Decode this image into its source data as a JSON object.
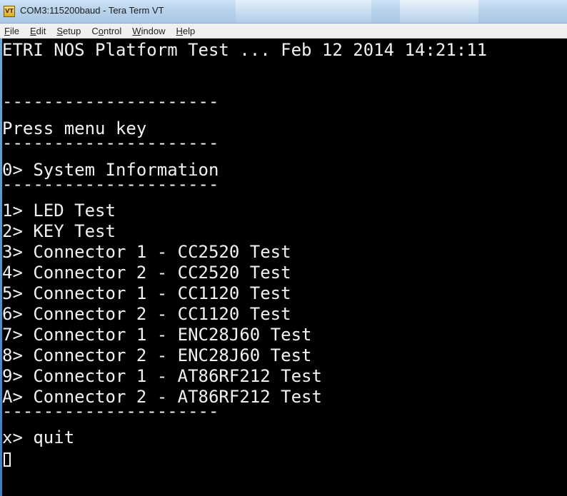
{
  "window": {
    "title": "COM3:115200baud - Tera Term VT",
    "icon": "tera-term-app-icon",
    "icon_glyph": "VT"
  },
  "menu": [
    {
      "name": "file",
      "accel": "F",
      "rest": "ile"
    },
    {
      "name": "edit",
      "accel": "E",
      "rest": "dit"
    },
    {
      "name": "setup",
      "accel": "S",
      "rest": "etup"
    },
    {
      "name": "control",
      "pre": "C",
      "accel": "o",
      "rest": "ntrol"
    },
    {
      "name": "window",
      "accel": "W",
      "rest": "indow"
    },
    {
      "name": "help",
      "accel": "H",
      "rest": "elp"
    }
  ],
  "terminal": {
    "header": "ETRI NOS Platform Test ... Feb 12 2014 14:21:11",
    "blank": "",
    "separator": "---------------------",
    "prompt": "Press menu key",
    "system_info": "0> System Information",
    "tests": [
      "1> LED Test",
      "2> KEY Test",
      "3> Connector 1 - CC2520 Test",
      "4> Connector 2 - CC2520 Test",
      "5> Connector 1 - CC1120 Test",
      "6> Connector 2 - CC1120 Test",
      "7> Connector 1 - ENC28J60 Test",
      "8> Connector 2 - ENC28J60 Test",
      "9> Connector 1 - AT86RF212 Test",
      "A> Connector 2 - AT86RF212 Test"
    ],
    "quit": "x> quit",
    "colors": {
      "background": "#000000",
      "foreground": "#f2f2f2"
    }
  }
}
